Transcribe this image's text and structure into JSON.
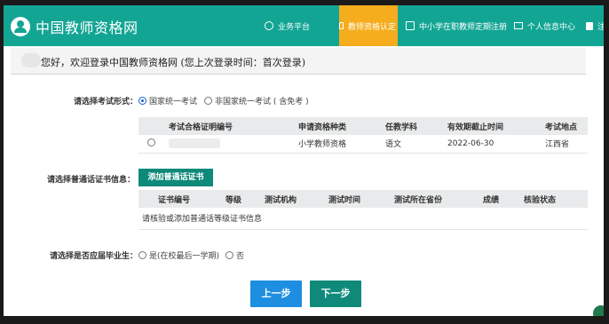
{
  "header": {
    "site_title": "中国教师资格网",
    "nav": [
      {
        "label": "业务平台",
        "icon": "platform-icon"
      },
      {
        "label": "教师资格认定",
        "icon": "monitor-icon"
      },
      {
        "label": "中小学在职教师定期注册",
        "icon": "edit-icon"
      },
      {
        "label": "个人信息中心",
        "icon": "monitor-icon"
      },
      {
        "label": "注",
        "icon": "exit-icon"
      }
    ],
    "colors": {
      "bar": "#13a594",
      "active": "#f5ad1d"
    }
  },
  "welcome": {
    "text": "您好，欢迎登录中国教师资格网 (您上次登录时间：首次登录)"
  },
  "exam_form": {
    "label": "请选择考试形式：",
    "options": [
      "国家统一考试",
      "非国家统一考试 ( 含免考 )"
    ],
    "selected": 0
  },
  "cert_table": {
    "headers": [
      "考试合格证明编号",
      "申请资格种类",
      "任教学科",
      "有效期截止时间",
      "考试地点"
    ],
    "rows": [
      {
        "id": "",
        "type": "小学教师资格",
        "subject": "语文",
        "expiry": "2022-06-30",
        "location": "江西省"
      }
    ]
  },
  "putonghua": {
    "label": "请选择普通话证书信息：",
    "add_button": "添加普通话证书",
    "headers": [
      "证书编号",
      "等级",
      "测试机构",
      "测试时间",
      "测试所在省份",
      "成绩",
      "核验状态"
    ],
    "empty_text": "请核验或添加普通话等级证书信息"
  },
  "graduate": {
    "label": "请选择是否应届毕业生：",
    "options": [
      "是(在校最后一学期)",
      "否"
    ]
  },
  "buttons": {
    "prev": "上一步",
    "next": "下一步"
  }
}
